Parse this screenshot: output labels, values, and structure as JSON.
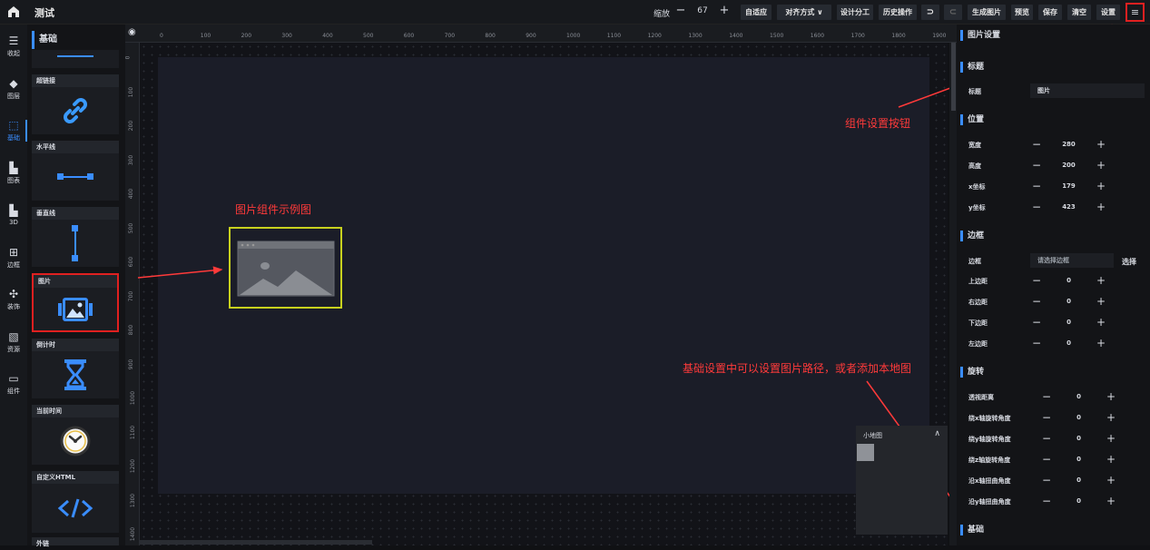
{
  "app": {
    "title": "测试",
    "logo_icon": "home-icon"
  },
  "toolbar": {
    "zoom_label": "缩放",
    "zoom_minus": "−",
    "zoom_value": "67",
    "zoom_plus": "+",
    "buttons": [
      "自适应",
      "对齐方式 ∨",
      "设计分工",
      "历史操作",
      "⊃",
      "⊂",
      "生成图片",
      "预览",
      "保存",
      "清空",
      "设置"
    ],
    "menu_icon": "≡"
  },
  "left_nav": [
    {
      "label": "收起",
      "icon": "☰"
    },
    {
      "label": "图层",
      "icon": "◆"
    },
    {
      "label": "基础",
      "icon": "⬚",
      "active": true
    },
    {
      "label": "图表",
      "icon": "▙"
    },
    {
      "label": "3D",
      "icon": "▙"
    },
    {
      "label": "边框",
      "icon": "⊞"
    },
    {
      "label": "装饰",
      "icon": "✣"
    },
    {
      "label": "资源",
      "icon": "▧"
    },
    {
      "label": "组件",
      "icon": "▭"
    }
  ],
  "library": {
    "header": "基础",
    "cards": [
      {
        "title": "超链接",
        "icon": "link-icon"
      },
      {
        "title": "水平线",
        "icon": "horizontal-line-icon"
      },
      {
        "title": "垂直线",
        "icon": "vertical-line-icon"
      },
      {
        "title": "图片",
        "icon": "image-icon",
        "selected": true
      },
      {
        "title": "倒计时",
        "icon": "hourglass-icon"
      },
      {
        "title": "当前时间",
        "icon": "clock-icon"
      },
      {
        "title": "自定义HTML",
        "icon": "code-icon"
      },
      {
        "title": "外链"
      }
    ]
  },
  "ruler": {
    "top": [
      "0",
      "100",
      "200",
      "300",
      "400",
      "500",
      "600",
      "700",
      "800",
      "900",
      "1000",
      "1100",
      "1200",
      "1300",
      "1400",
      "1500",
      "1600",
      "1700",
      "1800",
      "1900"
    ],
    "left": [
      "0",
      "100",
      "200",
      "300",
      "400",
      "500",
      "600",
      "700",
      "800",
      "900",
      "1000",
      "1100",
      "1200",
      "1300",
      "1400"
    ]
  },
  "annotations": {
    "image_example": "图片组件示例图",
    "settings_button": "组件设置按钮",
    "base_settings": "基础设置中可以设置图片路径，或者添加本地图"
  },
  "minimap": {
    "title": "小地图",
    "toggle": "∧"
  },
  "panel": {
    "title": "图片设置",
    "sections": {
      "title": "标题",
      "position": "位置",
      "border": "边框",
      "rotate": "旋转",
      "base": "基础"
    },
    "title_row": {
      "label": "标题",
      "value": "图片"
    },
    "position_rows": [
      {
        "label": "宽度",
        "value": "280"
      },
      {
        "label": "高度",
        "value": "200"
      },
      {
        "label": "x坐标",
        "value": "179"
      },
      {
        "label": "y坐标",
        "value": "423"
      }
    ],
    "border_row": {
      "label": "边框",
      "placeholder": "请选择边框",
      "action": "选择"
    },
    "padding_rows": [
      {
        "label": "上边距",
        "value": "0"
      },
      {
        "label": "右边距",
        "value": "0"
      },
      {
        "label": "下边距",
        "value": "0"
      },
      {
        "label": "左边距",
        "value": "0"
      }
    ],
    "rotate_rows": [
      {
        "label": "透视距离",
        "value": "0"
      },
      {
        "label": "绕x轴旋转角度",
        "value": "0"
      },
      {
        "label": "绕y轴旋转角度",
        "value": "0"
      },
      {
        "label": "绕z轴旋转角度",
        "value": "0"
      },
      {
        "label": "沿x轴扭曲角度",
        "value": "0"
      },
      {
        "label": "沿y轴扭曲角度",
        "value": "0"
      }
    ],
    "stepper_minus": "−",
    "stepper_plus": "+"
  },
  "colors": {
    "accent": "#3a8dff",
    "annotation": "#ff3a3a",
    "selection": "#c8d11e"
  }
}
